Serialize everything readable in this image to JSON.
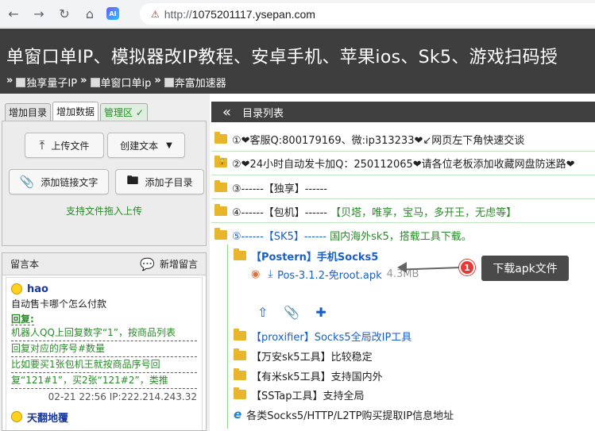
{
  "browser": {
    "url_prefix": "http://",
    "url_host": "1075201117.ysepan.com",
    "ai_badge": "AI"
  },
  "header": {
    "title": "单窗口单IP、模拟器改IP教程、安卓手机、苹果ios、Sk5、游戏扫码授",
    "breadcrumbs": [
      {
        "label": "独享量子IP"
      },
      {
        "label": "单窗口单ip"
      },
      {
        "label": "奔富加速器"
      }
    ],
    "crumb_sep": "»"
  },
  "left": {
    "tabs": [
      "增加目录",
      "增加数据",
      "管理区"
    ],
    "admin_check": "✓",
    "upload_button": "上传文件",
    "create_text_button": "创建文本",
    "add_link_button": "添加链接文字",
    "add_subdir_button": "添加子目录",
    "drag_hint": "支持文件拖入上传",
    "message_board": {
      "title": "留言本",
      "new_message": "新增留言",
      "messages": [
        {
          "user": "hao",
          "text": "自动售卡哪个怎么付款",
          "reply_label": "回复:",
          "reply_lines": [
            "机器人QQ上回复数字“1”，按商品列表",
            "回复对应的序号#数量",
            "比如要买1张包机王就按商品序号回",
            "复“121#1”，买2张“121#2”，类推"
          ],
          "meta": "02-21 22:56 IP:222.214.243.32"
        },
        {
          "user": "天翻地覆"
        }
      ]
    }
  },
  "right": {
    "collapse_icon": "«",
    "title": "目录列表",
    "rows": [
      {
        "text": "①❤客服Q:800179169、微:ip313233❤↙网页左下角快速交谈"
      },
      {
        "text": "②❤24小时自动发卡加Q：250112065❤请各位老板添加收藏网盘防迷路❤"
      },
      {
        "text": "③------【独享】------"
      },
      {
        "text": "④------【包机】------",
        "extra": "【贝塔，唯享，宝马，多开王，无虑等】"
      },
      {
        "text": "⑤------【SK5】------",
        "extra": "国内海外sk5，搭载工具下载。"
      }
    ],
    "sub_folder": "【Postern】手机Socks5",
    "file_name": "Pos-3.1.2-免root.apk",
    "file_size": "4.3MB",
    "sub_rows": [
      {
        "text": "【proxifier】Socks5全局改IP工具"
      },
      {
        "text": "【万安sk5工具】比较稳定"
      },
      {
        "text": "【有米sk5工具】支持国内外"
      },
      {
        "text": "【SSTap工具】支持全局"
      },
      {
        "text": "各类Socks5/HTTP/L2TP购买提取IP信息地址"
      }
    ]
  },
  "callout": {
    "number": "1",
    "label": "下载apk文件"
  }
}
